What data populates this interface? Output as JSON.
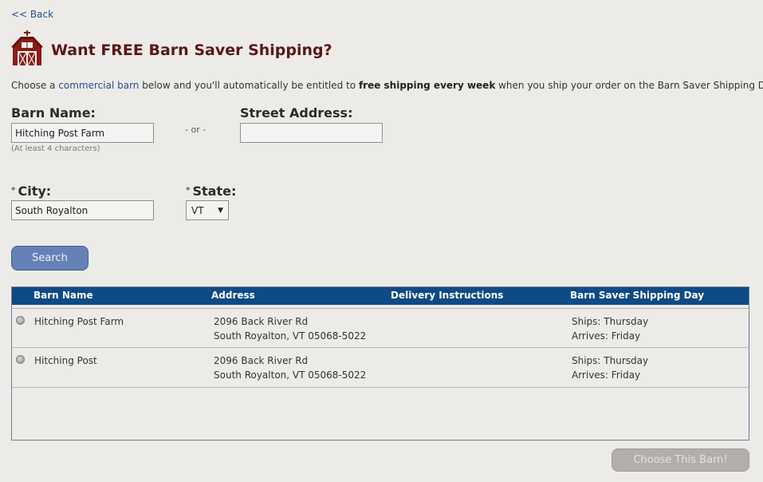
{
  "nav": {
    "back_label": "<< Back"
  },
  "header": {
    "title": "Want FREE Barn Saver Shipping?",
    "icon": "barn-icon"
  },
  "intro": {
    "part1": "Choose a ",
    "link": "commercial barn",
    "part2": " below and you'll automatically be entitled to ",
    "bold1": "free shipping every week",
    "part3": " when you ship your order on the Barn Saver Shipping Day!"
  },
  "form": {
    "barn_name_label": "Barn Name:",
    "barn_name_value": "Hitching Post Farm",
    "barn_name_hint": "(At least 4 characters)",
    "or_label": "- or -",
    "street_label": "Street Address:",
    "street_value": "",
    "required_mark": "*",
    "city_label": "City:",
    "city_value": "South Royalton",
    "state_label": "State:",
    "state_value": "VT",
    "search_label": "Search"
  },
  "results": {
    "headers": [
      "Barn Name",
      "Address",
      "Delivery Instructions",
      "Barn Saver Shipping Day"
    ],
    "rows": [
      {
        "name": "Hitching Post Farm",
        "address1": "2096 Back River Rd",
        "address2": "South Royalton, VT 05068-5022",
        "instructions": "",
        "ships": "Ships: Thursday",
        "arrives": "Arrives: Friday"
      },
      {
        "name": "Hitching Post",
        "address1": "2096 Back River Rd",
        "address2": "South Royalton, VT 05068-5022",
        "instructions": "",
        "ships": "Ships: Thursday",
        "arrives": "Arrives: Friday"
      }
    ]
  },
  "footer": {
    "choose_label": "Choose This Barn!"
  },
  "colors": {
    "background": "#edebe8",
    "header_bar": "#0e4a86",
    "title": "#5a1717",
    "search_button": "#6581b8",
    "choose_button_disabled": "#b4aeab"
  }
}
